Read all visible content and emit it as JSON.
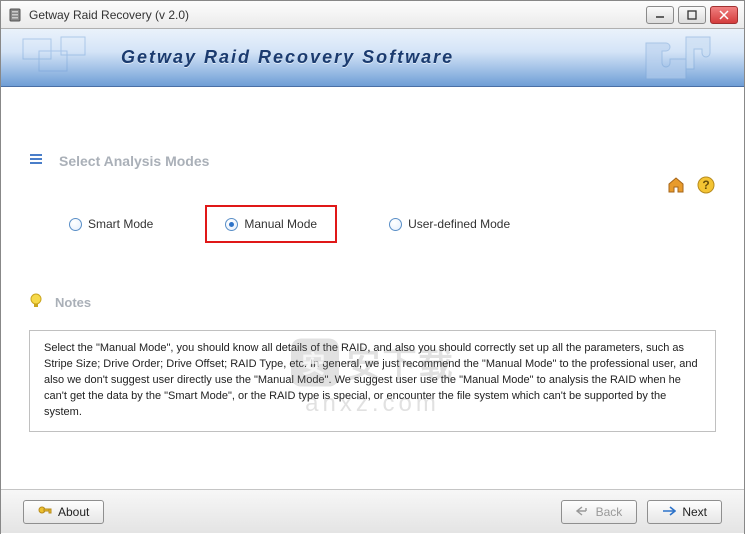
{
  "window": {
    "title": "Getway Raid Recovery (v 2.0)"
  },
  "banner": {
    "title": "Getway Raid Recovery Software"
  },
  "section": {
    "title": "Select Analysis Modes"
  },
  "modes": {
    "smart": "Smart Mode",
    "manual": "Manual Mode",
    "userdefined": "User-defined Mode",
    "selected": "manual"
  },
  "notes": {
    "title": "Notes",
    "body": "Select the \"Manual Mode\", you should know all details of the RAID, and also you should correctly set up all the parameters, such as Stripe Size; Drive Order; Drive Offset; RAID Type, etc. In general, we just recommend the \"Manual Mode\" to the professional user, and also we don't suggest user directly use the \"Manual Mode\". We suggest user use the \"Manual Mode\" to analysis the RAID when he can't get the data by the \"Smart Mode\", or the RAID type is special, or encounter the file system which can't be supported by the system."
  },
  "buttons": {
    "about": "About",
    "back": "Back",
    "next": "Next"
  },
  "watermark": {
    "line1": "安下载",
    "line2": "anxz.com"
  }
}
